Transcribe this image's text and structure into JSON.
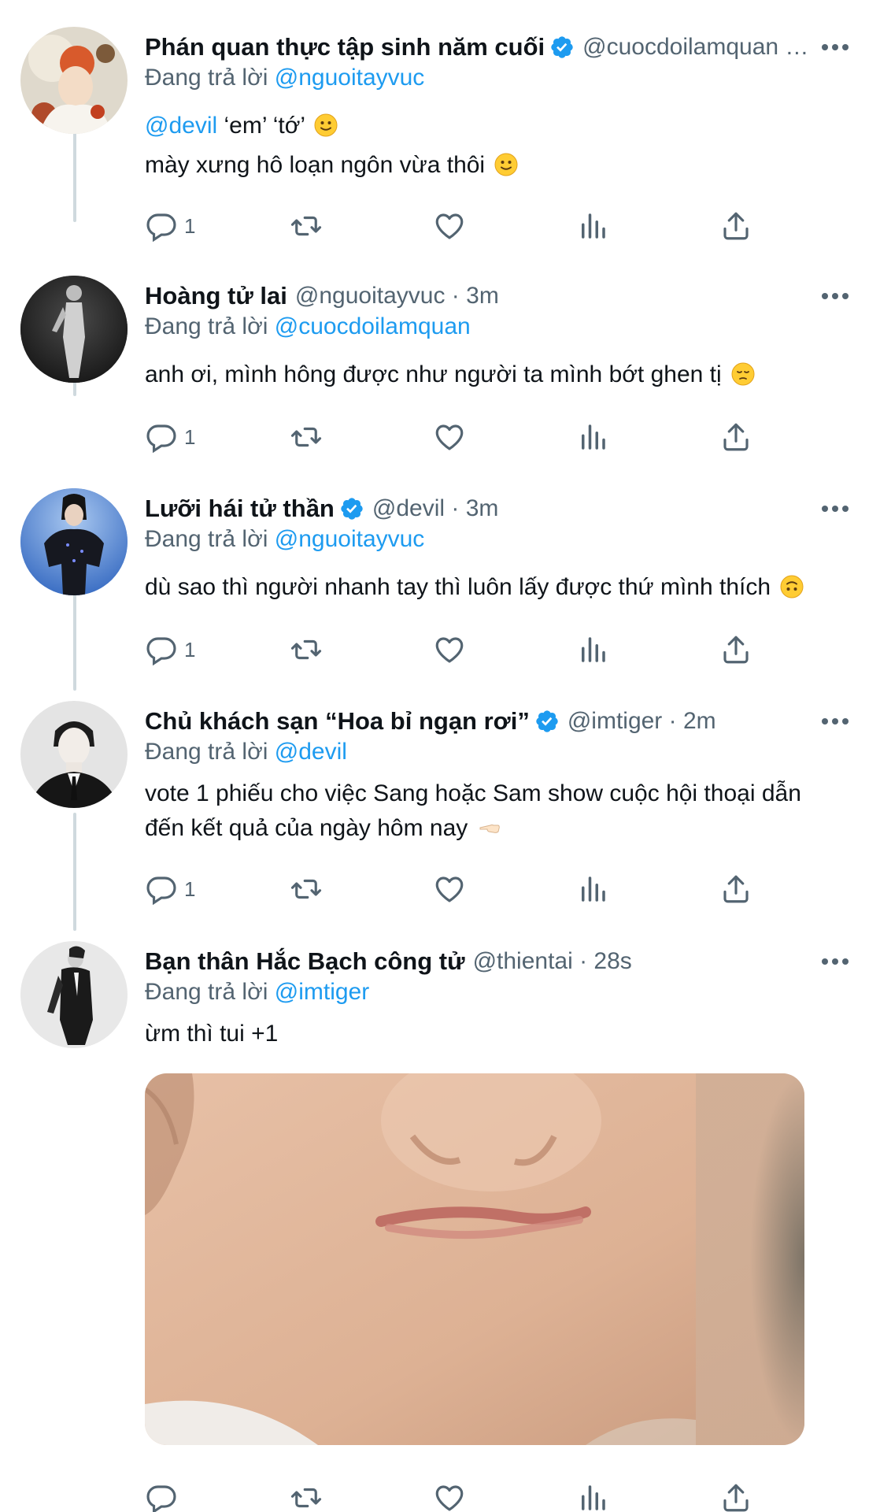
{
  "colors": {
    "accent": "#1d9bf0",
    "secondary_text": "#536471",
    "primary_text": "#0f1419",
    "thread_line": "#cfd9de"
  },
  "replying_label": "Đang trả lời",
  "tweets": [
    {
      "name": "Phán quan thực tập sinh năm cuối",
      "verified": true,
      "handle": "@cuocdoilamquan …",
      "replying_to": "@nguoitayvuc",
      "body_line1_mention": "@devil",
      "body_line1_text": " ‘em’ ‘tớ’",
      "body_line2_text": "mày xưng hô loạn ngôn vừa thôi",
      "reply_count": "1"
    },
    {
      "name": "Hoàng tử lai",
      "verified": false,
      "handle": "@nguoitayvuc · 3m",
      "replying_to": "@cuocdoilamquan",
      "body_text": "anh ơi, mình hông được như người ta mình bớt ghen tị",
      "reply_count": "1"
    },
    {
      "name": "Lưỡi hái tử thần",
      "verified": true,
      "handle": "@devil · 3m",
      "replying_to": "@nguoitayvuc",
      "body_text": "dù sao thì người nhanh tay thì luôn lấy được thứ mình thích",
      "reply_count": "1"
    },
    {
      "name": "Chủ khách sạn “Hoa bỉ ngạn rơi”",
      "verified": true,
      "handle": "@imtiger · 2m",
      "replying_to": "@devil",
      "body_line1_text": "vote 1 phiếu cho việc Sang hoặc Sam show cuộc hội thoại dẫn",
      "body_line2_text": "đến kết quả của ngày hôm nay",
      "reply_count": "1"
    },
    {
      "name": "Bạn thân Hắc Bạch công tử",
      "verified": false,
      "handle": "@thientai · 28s",
      "replying_to": "@imtiger",
      "body_text": "ừm thì tui +1",
      "reply_count": ""
    }
  ],
  "icons": {
    "reply": "reply-icon",
    "retweet": "retweet-icon",
    "like": "heart-icon",
    "views": "analytics-icon",
    "share": "share-icon",
    "more": "more-icon",
    "verified": "verified-badge-icon"
  }
}
